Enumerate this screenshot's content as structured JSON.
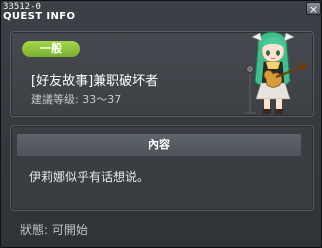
{
  "window": {
    "code": "33512-0",
    "title": "QUEST INFO",
    "close_label": "×"
  },
  "quest": {
    "category": "一般",
    "name": "[好友故事]兼职破坏者",
    "level": "建議等级: 33～37"
  },
  "npc": {
    "icon": "npc-portrait-green-hair-guitar"
  },
  "content": {
    "header": "內容",
    "text": "伊莉娜似乎有话想说。"
  },
  "status": {
    "text": "狀態: 可開始"
  },
  "colors": {
    "badge": "#8cc63f",
    "npc_hair": "#3fbf8c"
  }
}
